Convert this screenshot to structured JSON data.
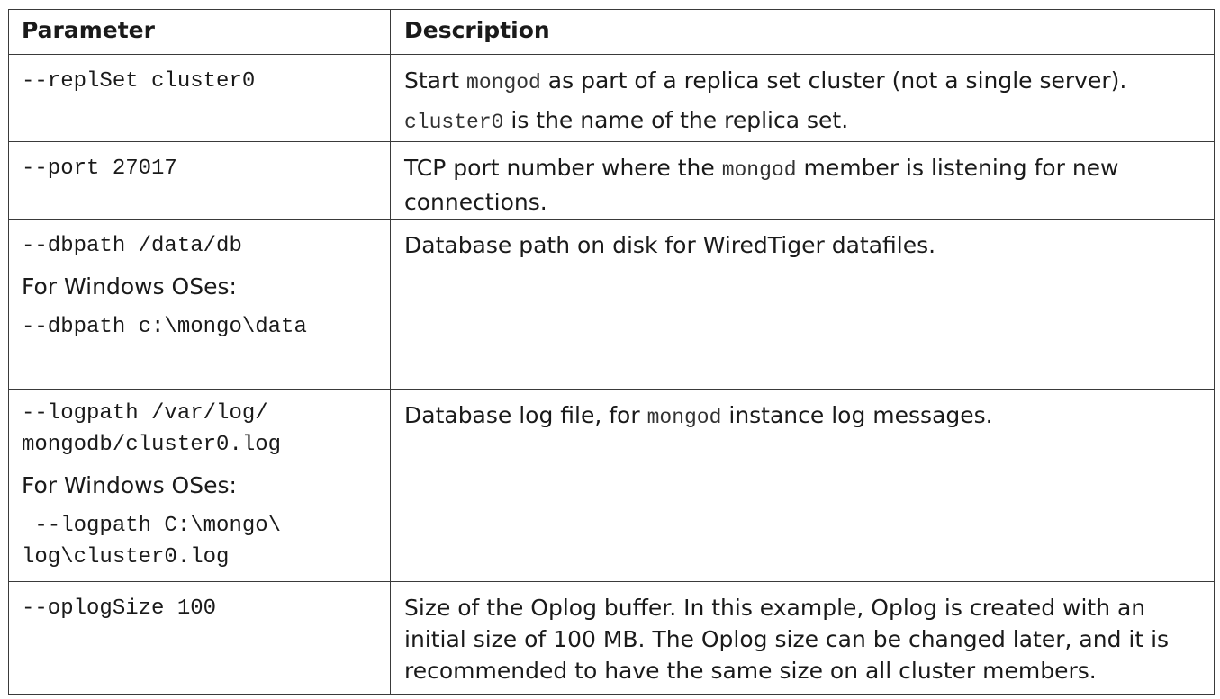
{
  "headers": {
    "parameter": "Parameter",
    "description": "Description"
  },
  "rows": [
    {
      "param_lines": [
        "--replSet cluster0"
      ],
      "desc": {
        "p1_pre": "Start ",
        "p1_code": "mongod",
        "p1_post": " as part of a replica set cluster (not a single server).",
        "p2_code": "cluster0",
        "p2_post": " is the name of the replica set."
      }
    },
    {
      "param_lines": [
        "--port 27017"
      ],
      "desc": {
        "pre": "TCP port number where the ",
        "code": "mongod",
        "post": " member is listening for new connections."
      }
    },
    {
      "param_lines": [
        "--dbpath /data/db",
        "For Windows OSes:",
        "--dbpath c:\\mongo\\data"
      ],
      "desc": {
        "text": "Database path on disk for WiredTiger datafiles."
      }
    },
    {
      "param_lines": [
        "--logpath /var/log/",
        "mongodb/cluster0.log",
        "For Windows OSes:",
        " --logpath C:\\mongo\\",
        "log\\cluster0.log"
      ],
      "desc": {
        "pre": "Database log file, for ",
        "code": "mongod",
        "post": " instance log messages."
      }
    },
    {
      "param_lines": [
        "--oplogSize 100"
      ],
      "desc": {
        "text": "Size of the Oplog buffer. In this example, Oplog is created with an initial size of 100 MB. The Oplog size can be changed later, and it is recommended to have the same size on all cluster members."
      }
    }
  ]
}
